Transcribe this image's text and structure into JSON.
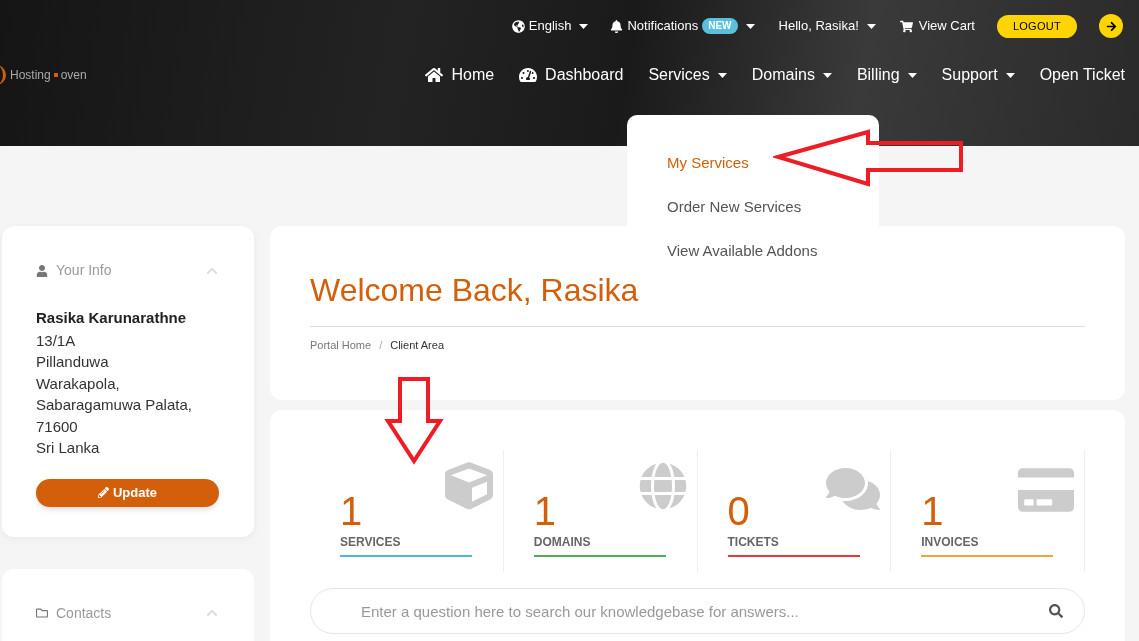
{
  "logo": {
    "word1": "Hosting",
    "word2": "oven"
  },
  "top_bar": {
    "language": "English",
    "notifications": {
      "label": "Notifications",
      "badge": "NEW"
    },
    "greeting": "Hello, Rasika!",
    "cart": "View Cart",
    "logout": "LOGOUT"
  },
  "nav": [
    {
      "label": "Home",
      "kind": "home"
    },
    {
      "label": "Dashboard",
      "kind": "dashboard"
    },
    {
      "label": "Services",
      "kind": "menu"
    },
    {
      "label": "Domains",
      "kind": "menu"
    },
    {
      "label": "Billing",
      "kind": "menu"
    },
    {
      "label": "Support",
      "kind": "menu"
    },
    {
      "label": "Open Ticket",
      "kind": "link"
    }
  ],
  "services_menu": [
    {
      "label": "My Services",
      "selected": true
    },
    {
      "label": "Order New Services",
      "selected": false
    },
    {
      "label": "View Available Addons",
      "selected": false
    }
  ],
  "your_info": {
    "title": "Your Info",
    "name": "Rasika Karunarathne",
    "address": [
      "13/1A",
      "Pillanduwa",
      "Warakapola,",
      "Sabaragamuwa Palata,",
      "71600",
      "Sri Lanka"
    ],
    "button": "Update"
  },
  "contacts": {
    "title": "Contacts"
  },
  "welcome": {
    "title": "Welcome Back, Rasika",
    "breadcrumb": [
      {
        "label": "Portal Home",
        "selected": false
      },
      {
        "label": "Client Area",
        "selected": true
      }
    ],
    "separator": "/"
  },
  "stats": [
    {
      "value": "1",
      "label": "SERVICES",
      "kind": "services",
      "color": "#4db6e2"
    },
    {
      "value": "1",
      "label": "DOMAINS",
      "kind": "domains",
      "color": "#4caf50"
    },
    {
      "value": "0",
      "label": "TICKETS",
      "kind": "tickets",
      "color": "#e53935"
    },
    {
      "value": "1",
      "label": "INVOICES",
      "kind": "invoices",
      "color": "#f0a33a"
    }
  ],
  "search": {
    "placeholder": "Enter a question here to search our knowledgebase for answers..."
  }
}
